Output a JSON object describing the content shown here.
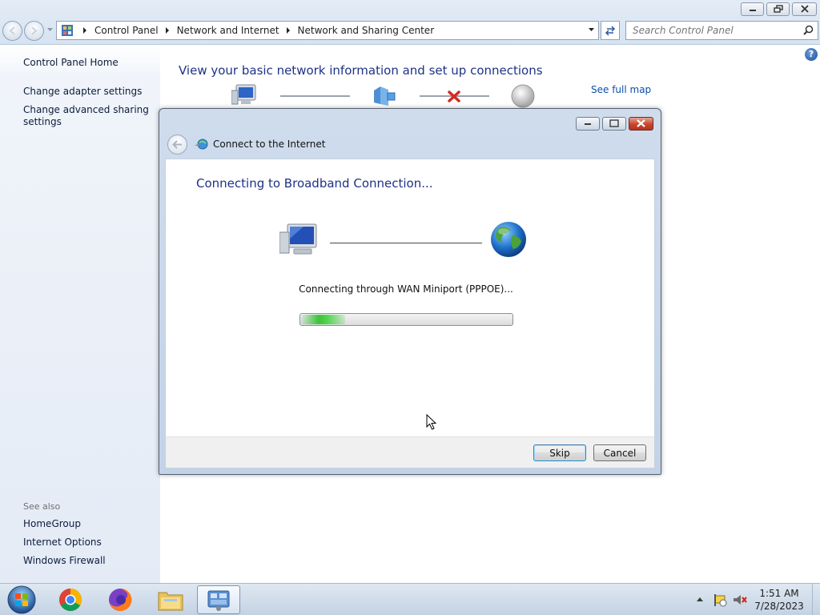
{
  "window": {
    "breadcrumbs": [
      "Control Panel",
      "Network and Internet",
      "Network and Sharing Center"
    ],
    "search_placeholder": "Search Control Panel"
  },
  "sidebar": {
    "links": [
      "Control Panel Home",
      "Change adapter settings",
      "Change advanced sharing settings"
    ],
    "see_also_label": "See also",
    "see_also_links": [
      "HomeGroup",
      "Internet Options",
      "Windows Firewall"
    ]
  },
  "main": {
    "heading": "View your basic network information and set up connections",
    "see_full_map": "See full map"
  },
  "dialog": {
    "title": "Connect to the Internet",
    "heading": "Connecting to Broadband Connection...",
    "status": "Connecting through WAN Miniport (PPPOE)...",
    "buttons": {
      "skip": "Skip",
      "cancel": "Cancel"
    },
    "progress": "indeterminate"
  },
  "taskbar": {
    "time": "1:51 AM",
    "date": "7/28/2023"
  }
}
